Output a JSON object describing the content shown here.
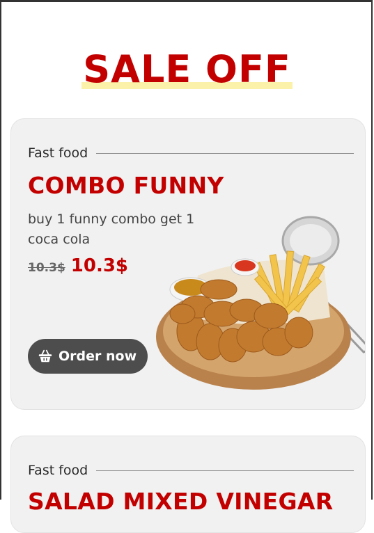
{
  "section": {
    "title": "SALE OFF"
  },
  "cards": [
    {
      "category": "Fast food",
      "name": "COMBO FUNNY",
      "description": "buy 1 funny combo get 1 coca cola",
      "old_price": "10.3$",
      "new_price": "10.3$",
      "order_label": "Order now",
      "icon": "basket-icon"
    },
    {
      "category": "Fast food",
      "name": "SALAD MIXED VINEGAR"
    }
  ],
  "colors": {
    "accent": "#c30000",
    "button": "#4d4d4d",
    "card_bg": "#f1f1f1",
    "highlight": "#fbf1a8"
  }
}
